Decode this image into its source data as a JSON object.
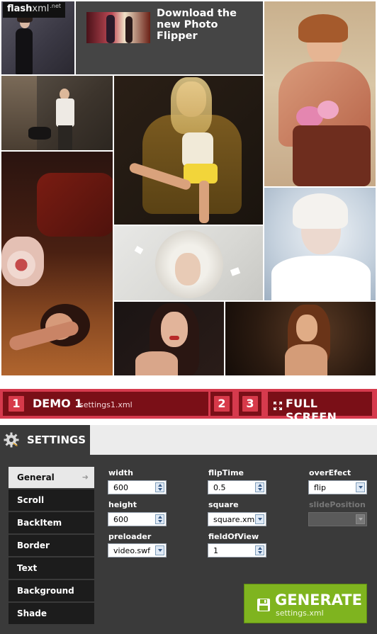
{
  "logo": {
    "main": "flash",
    "xml": "xml",
    "tld": ".net"
  },
  "promo": {
    "text": "Download the new Photo Flipper"
  },
  "gallery": {
    "tiles": [
      "photo-woman-dark-dress",
      "promo-download",
      "photo-woman-scarf-flowers",
      "photo-man-dog",
      "photo-blonde-chair",
      "photo-woman-floor",
      "photo-curly-blonde-butterflies",
      "photo-woman-white-fur",
      "photo-woman-dark-hair",
      "photo-woman-brown-hair"
    ]
  },
  "demobar": {
    "demo1_num": "1",
    "demo1_title": "DEMO 1",
    "demo1_file": "settings1.xml",
    "demo2_num": "2",
    "demo3_num": "3",
    "fullscreen_label": "FULL SCREEN"
  },
  "settings": {
    "tab_label": "SETTINGS",
    "nav": [
      "General",
      "Scroll",
      "BackItem",
      "Border",
      "Text",
      "Background",
      "Shade"
    ],
    "active_nav": "General",
    "fields": {
      "width": {
        "label": "width",
        "value": "600"
      },
      "height": {
        "label": "height",
        "value": "600"
      },
      "preloader": {
        "label": "preloader",
        "value": "video.swf"
      },
      "flipTime": {
        "label": "flipTime",
        "value": "0.5"
      },
      "square": {
        "label": "square",
        "value": "square.xm"
      },
      "fieldOfView": {
        "label": "fieldOfView",
        "value": "1"
      },
      "overEfect": {
        "label": "overEfect",
        "value": "flip"
      },
      "slidePosition": {
        "label": "slidePosition",
        "value": ""
      }
    }
  },
  "generate": {
    "title": "GENERATE",
    "subtitle": "settings.xml"
  },
  "colors": {
    "demobar_bg": "#d63a4d",
    "demobar_box": "#7a0f17",
    "panel_bg": "#3a3a3a",
    "generate_bg": "#7fb41f"
  }
}
